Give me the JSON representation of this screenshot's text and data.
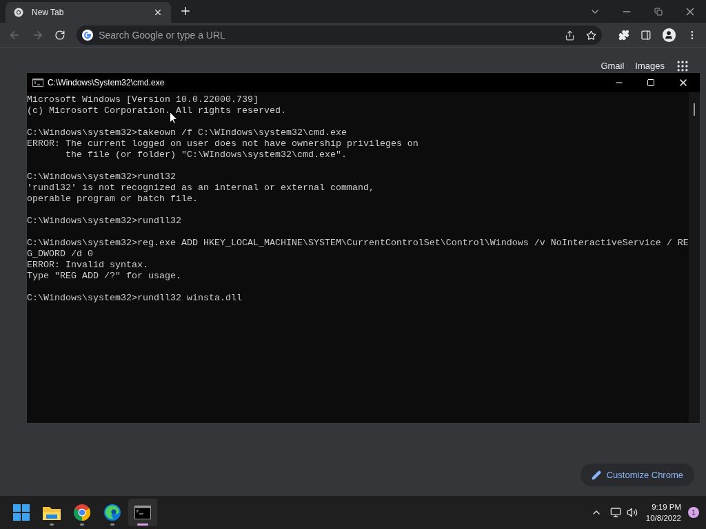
{
  "browser": {
    "tabs": [
      {
        "title": "New Tab",
        "selected": true
      }
    ],
    "omnibox": {
      "placeholder": "Search Google or type a URL"
    },
    "back_disabled": true,
    "forward_disabled": true
  },
  "ntp": {
    "links": [
      "Gmail",
      "Images"
    ],
    "customize_button": "Customize Chrome"
  },
  "console_window": {
    "title": "C:\\Windows\\System32\\cmd.exe",
    "blocks": [
      [
        "Microsoft Windows [Version 10.0.22000.739]",
        "(c) Microsoft Corporation. All rights reserved."
      ],
      [
        "C:\\Windows\\system32>takeown /f C:\\WIndows\\system32\\cmd.exe",
        "ERROR: The current logged on user does not have ownership privileges on",
        "       the file (or folder) \"C:\\WIndows\\system32\\cmd.exe\"."
      ],
      [
        "C:\\Windows\\system32>rundl32",
        "'rundl32' is not recognized as an internal or external command,",
        "operable program or batch file."
      ],
      [
        "C:\\Windows\\system32>rundll32"
      ],
      [
        "C:\\Windows\\system32>reg.exe ADD HKEY_LOCAL_MACHINE\\SYSTEM\\CurrentControlSet\\Control\\Windows /v NoInteractiveService / RE",
        "G_DWORD /d 0",
        "ERROR: Invalid syntax.",
        "Type \"REG ADD /?\" for usage."
      ],
      [
        "C:\\Windows\\system32>rundll32 winsta.dll"
      ]
    ]
  },
  "taskbar": {
    "apps": [
      {
        "kind": "start",
        "running": false,
        "selected": false
      },
      {
        "kind": "explorer",
        "running": true,
        "selected": false
      },
      {
        "kind": "chrome",
        "running": true,
        "selected": false
      },
      {
        "kind": "edge",
        "running": true,
        "selected": false
      },
      {
        "kind": "terminal",
        "running": true,
        "selected": true
      }
    ],
    "time": "9:19 PM",
    "date": "10/8/2022",
    "notifications": "1"
  }
}
